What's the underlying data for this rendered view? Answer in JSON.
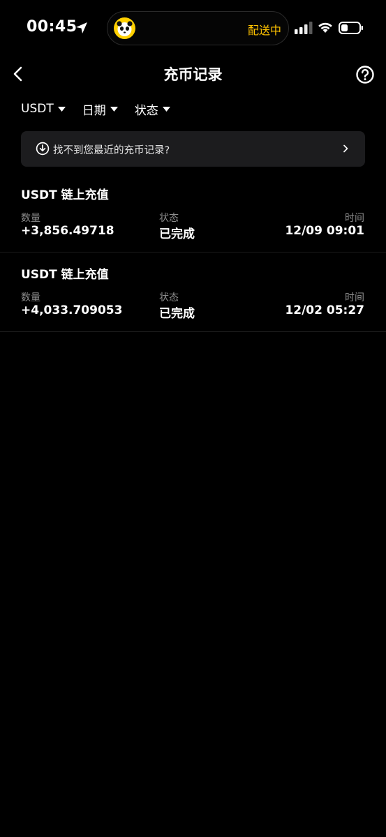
{
  "status_bar": {
    "time": "00:45",
    "island_text": "配送中"
  },
  "nav": {
    "title": "充币记录"
  },
  "filters": [
    {
      "label": "USDT"
    },
    {
      "label": "日期"
    },
    {
      "label": "状态"
    }
  ],
  "notice": {
    "text": "找不到您最近的充币记录?"
  },
  "records": [
    {
      "title": "USDT 链上充值",
      "amount_label": "数量",
      "amount": "+3,856.49718",
      "status_label": "状态",
      "status": "已完成",
      "time_label": "时间",
      "time": "12/09 09:01"
    },
    {
      "title": "USDT 链上充值",
      "amount_label": "数量",
      "amount": "+4,033.709053",
      "status_label": "状态",
      "status": "已完成",
      "time_label": "时间",
      "time": "12/02 05:27"
    }
  ],
  "colors": {
    "background": "#000000",
    "accent": "#ffc300",
    "card": "#1c1c1e",
    "muted_text": "#8d8d8d"
  },
  "icons": {
    "location": "location-arrow-icon",
    "signal": "cellular-signal-icon",
    "wifi": "wifi-icon",
    "battery": "battery-icon",
    "back": "chevron-left-icon",
    "help": "question-circle-icon",
    "notice": "download-circle-icon",
    "notice_arrow": "chevron-right-icon"
  }
}
